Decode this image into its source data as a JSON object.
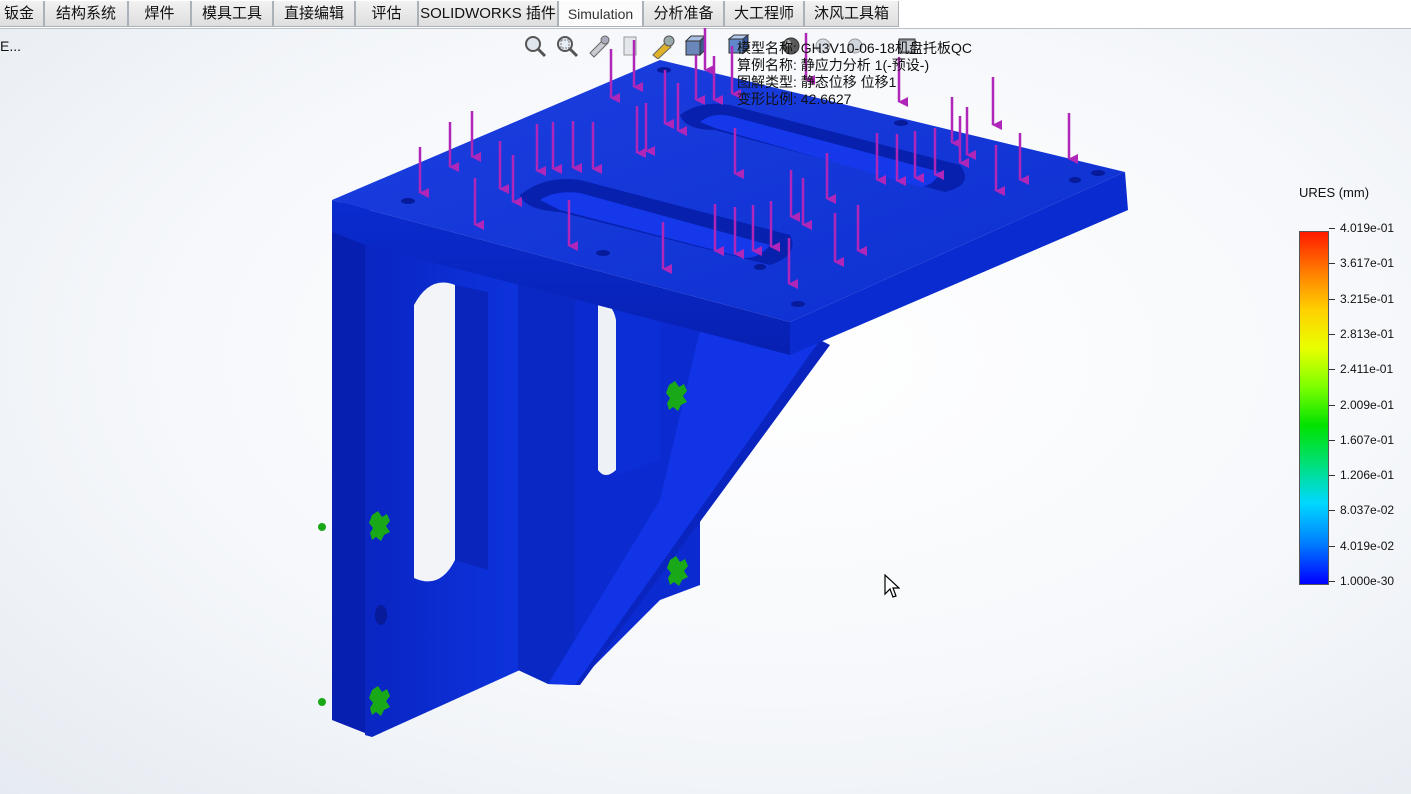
{
  "tabs": [
    {
      "label": "钣金"
    },
    {
      "label": "结构系统"
    },
    {
      "label": "焊件"
    },
    {
      "label": "模具工具"
    },
    {
      "label": "直接编辑"
    },
    {
      "label": "评估"
    },
    {
      "label": "SOLIDWORKS 插件"
    },
    {
      "label": "Simulation",
      "active": true
    },
    {
      "label": "分析准备"
    },
    {
      "label": "大工程师"
    },
    {
      "label": "沐风工具箱"
    }
  ],
  "corner_text": "E...",
  "view_toolbar": {
    "icons": [
      "zoom-to-fit-icon",
      "zoom-area-icon",
      "previous-view-icon",
      "section-view-icon",
      "view-orientation-icon",
      "display-style-icon",
      "hide-show-items-icon",
      "edit-appearance-icon",
      "apply-scene-icon",
      "view-settings-icon"
    ]
  },
  "plot_info": {
    "model_name": "模型名称: GH3V10-06-18机盘托板QC",
    "study_name": "算例名称: 静应力分析 1(-预设-)",
    "plot_type": "图解类型: 静态位移 位移1",
    "deformation_scale": "变形比例: 42.6627"
  },
  "legend": {
    "title": "URES (mm)",
    "labels": [
      "4.019e-01",
      "3.617e-01",
      "3.215e-01",
      "2.813e-01",
      "2.411e-01",
      "2.009e-01",
      "1.607e-01",
      "1.206e-01",
      "8.037e-02",
      "4.019e-02",
      "1.000e-30"
    ],
    "colors": {
      "max": "#ff1a00",
      "min": "#0000ff"
    }
  },
  "model_colors": {
    "part": "#0b2fd6",
    "load_arrow": "#b026b8",
    "fixture": "#18a818"
  }
}
